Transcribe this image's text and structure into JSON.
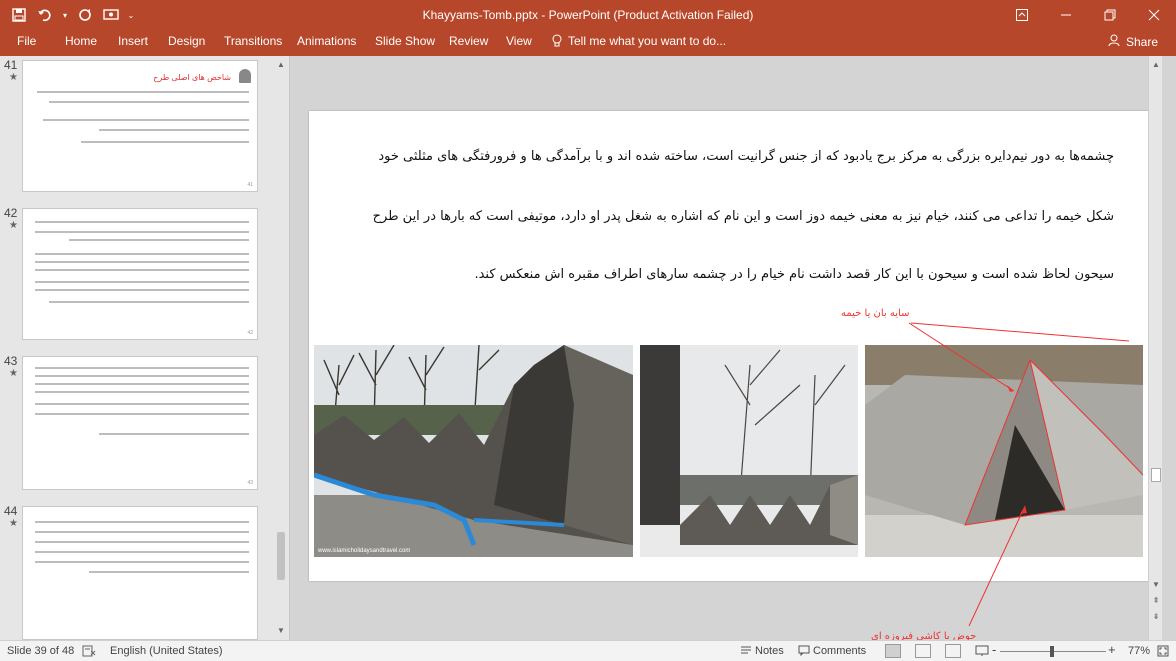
{
  "titlebar": {
    "title": "Khayyams-Tomb.pptx  -  PowerPoint (Product Activation Failed)",
    "save_icon": "save-icon",
    "undo_icon": "undo-icon",
    "redo_icon": "redo-icon"
  },
  "ribbon": {
    "tabs": [
      "File",
      "Home",
      "Insert",
      "Design",
      "Transitions",
      "Animations",
      "Slide Show",
      "Review",
      "View"
    ],
    "tell_me": "Tell me what you want to do...",
    "share": "Share"
  },
  "thumbnails": [
    {
      "number": "41",
      "star": "★",
      "title": "شاخص های اصلی طرح"
    },
    {
      "number": "42",
      "star": "★"
    },
    {
      "number": "43",
      "star": "★"
    },
    {
      "number": "44",
      "star": "★"
    }
  ],
  "slide": {
    "line1": "چشمه‌ها به دور نیم‌دایره بزرگی به مرکز برج یادبود که از جنس گرانیت است، ساخته شده اند و با برآمدگی ها و فرورفتگی های مثلثی خود",
    "line2": "شکل خیمه را تداعی می کنند، خیام نیز به معنی خیمه دوز است و این نام که اشاره به شغل پدر او دارد، موتیفی است که بارها در این طرح",
    "line3": "سیحون لحاظ شده است و سیحون با این کار قصد داشت نام خیام را در چشمه سارهای اطراف مقبره اش منعکس کند.",
    "annotation_top": "سایه بان یا خیمه",
    "annotation_bottom": "حوض با کاشی فیروزه ای",
    "photo_watermark": "www.islamicholidaysandtravel.com"
  },
  "status": {
    "slide_of": "Slide 39 of 48",
    "language": "English (United States)",
    "notes": "Notes",
    "comments": "Comments",
    "zoom_minus": "-",
    "zoom_plus": "+",
    "zoom": "77%"
  }
}
